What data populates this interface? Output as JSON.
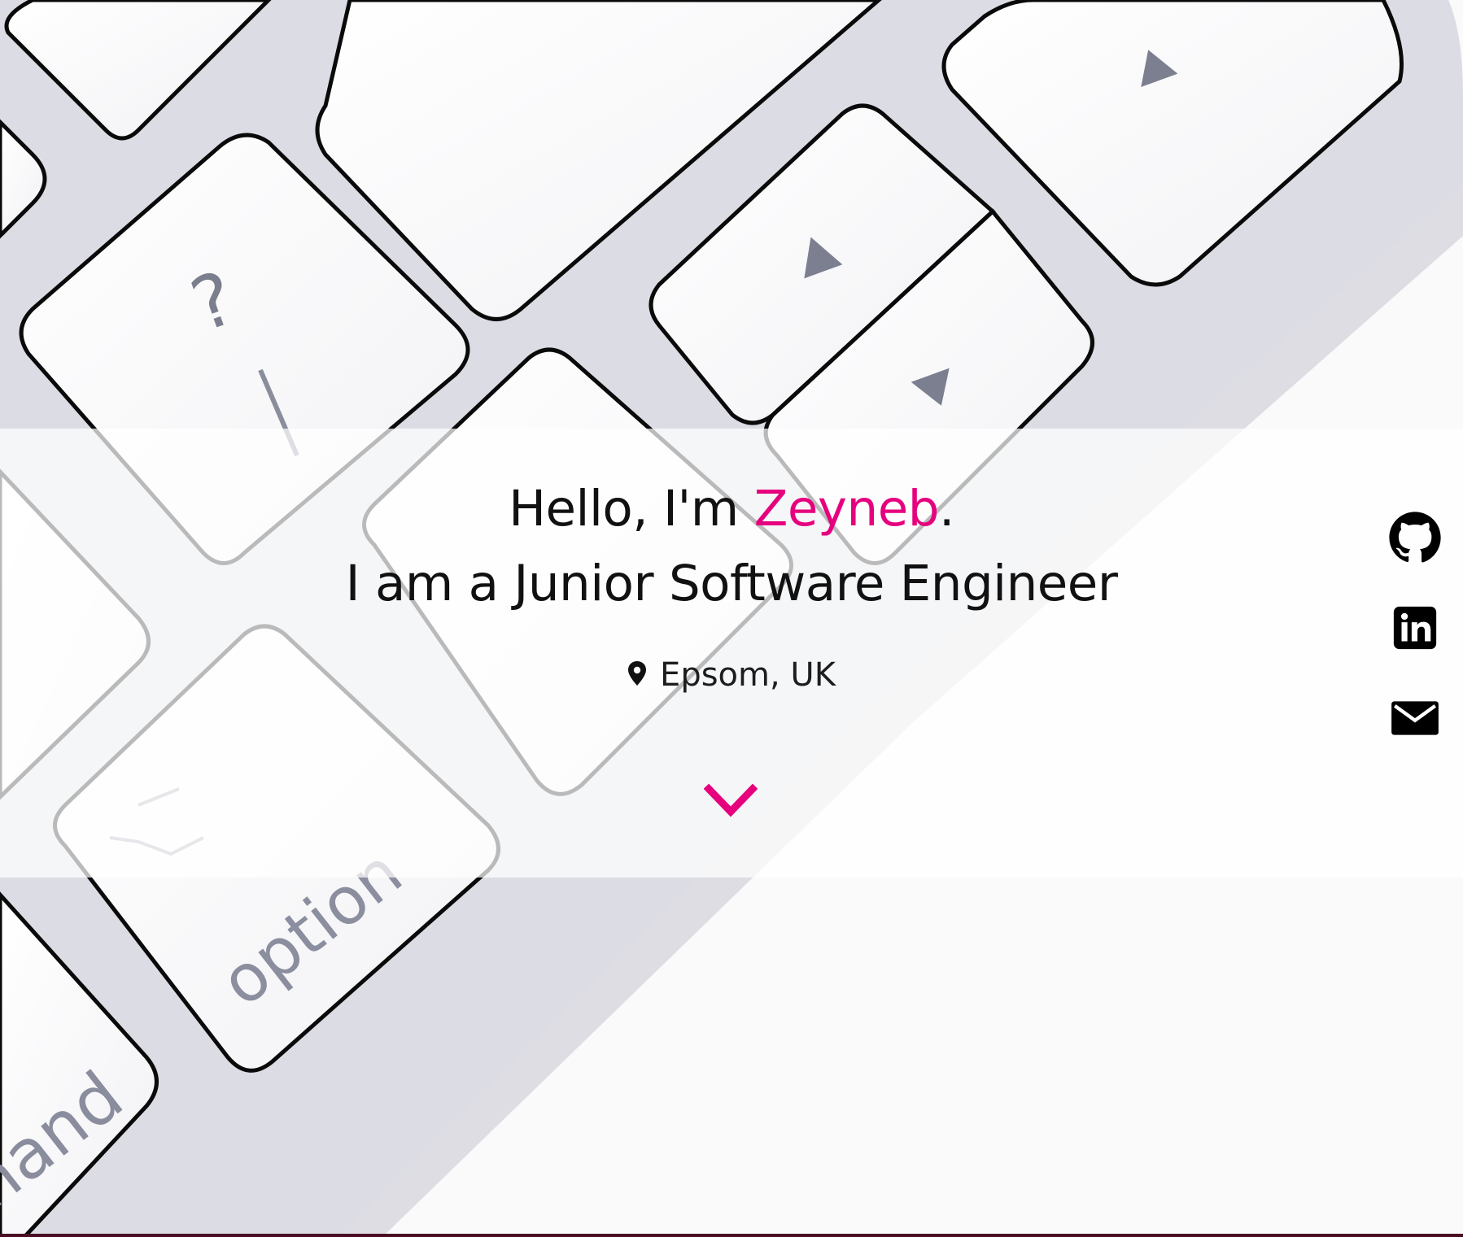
{
  "hero": {
    "greeting_prefix": "Hello, I'm ",
    "name": "Zeyneb",
    "greeting_suffix": ".",
    "role_line": "I am a Junior Software Engineer",
    "location": "Epsom, UK",
    "accent_color": "#e6007e"
  },
  "background": {
    "keyboard_labels": {
      "question": "?",
      "slash": "/",
      "option": "option",
      "command_fragment": "nand"
    }
  },
  "icons": {
    "location": "map-pin-icon",
    "scroll": "chevron-down-icon",
    "github": "github-icon",
    "linkedin": "linkedin-icon",
    "email": "email-icon"
  }
}
